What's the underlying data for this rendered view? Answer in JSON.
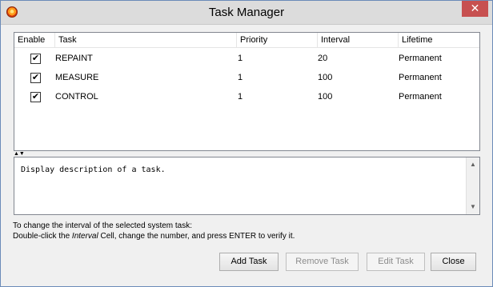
{
  "window": {
    "title": "Task Manager",
    "close_glyph": "✕",
    "app_icon": "app-sun-icon"
  },
  "table": {
    "columns": [
      "Enable",
      "Task",
      "Priority",
      "Interval",
      "Lifetime"
    ],
    "rows": [
      {
        "enabled": true,
        "task": "REPAINT",
        "priority": "1",
        "interval": "20",
        "lifetime": "Permanent"
      },
      {
        "enabled": true,
        "task": "MEASURE",
        "priority": "1",
        "interval": "100",
        "lifetime": "Permanent"
      },
      {
        "enabled": true,
        "task": "CONTROL",
        "priority": "1",
        "interval": "100",
        "lifetime": "Permanent"
      }
    ],
    "check_glyph": "✔"
  },
  "splitter": {
    "glyphs": "▲▼"
  },
  "description": {
    "text": "Display description of a task."
  },
  "hints": {
    "line1": "To change the interval of the selected system task:",
    "line2_prefix": "Double-click the ",
    "line2_em": "Interval",
    "line2_suffix": " Cell, change the number, and press ENTER to verify it."
  },
  "buttons": {
    "add": "Add Task",
    "remove": "Remove Task",
    "edit": "Edit Task",
    "close": "Close"
  }
}
